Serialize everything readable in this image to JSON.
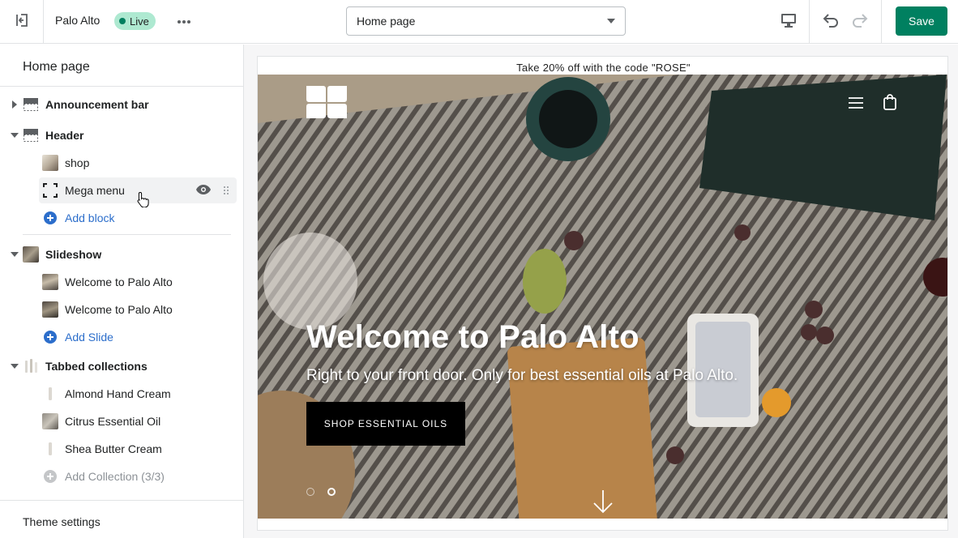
{
  "topbar": {
    "theme_name": "Palo Alto",
    "status_badge": "Live",
    "page_select_value": "Home page",
    "save_label": "Save"
  },
  "sidebar": {
    "title": "Home page",
    "sections": [
      {
        "label": "Announcement bar",
        "expanded": false
      },
      {
        "label": "Header",
        "expanded": true,
        "blocks": [
          {
            "label": "shop"
          },
          {
            "label": "Mega menu",
            "selected": true
          }
        ],
        "add_label": "Add block"
      },
      {
        "label": "Slideshow",
        "expanded": true,
        "blocks": [
          {
            "label": "Welcome to Palo Alto"
          },
          {
            "label": "Welcome to Palo Alto"
          }
        ],
        "add_label": "Add Slide"
      },
      {
        "label": "Tabbed collections",
        "expanded": true,
        "blocks": [
          {
            "label": "Almond Hand Cream"
          },
          {
            "label": "Citrus Essential Oil"
          },
          {
            "label": "Shea Butter Cream"
          }
        ],
        "add_label": "Add Collection (3/3)"
      }
    ],
    "footer_label": "Theme settings"
  },
  "preview": {
    "announcement": "Take 20% off with the code \"ROSE\"",
    "hero_title": "Welcome to Palo Alto",
    "hero_subtitle": "Right to your front door. Only for best essential oils at Palo Alto.",
    "hero_cta": "SHOP ESSENTIAL OILS",
    "slide_count": 2,
    "active_slide": 2
  },
  "colors": {
    "accent": "#008060",
    "live_badge": "#aee9d1",
    "link": "#2c6ecb"
  },
  "icons": [
    "exit-icon",
    "more-icon",
    "desktop-icon",
    "undo-icon",
    "redo-icon",
    "eye-icon",
    "drag-handle-icon",
    "plus-circle-icon",
    "menu-icon",
    "bag-icon",
    "down-arrow-icon"
  ]
}
